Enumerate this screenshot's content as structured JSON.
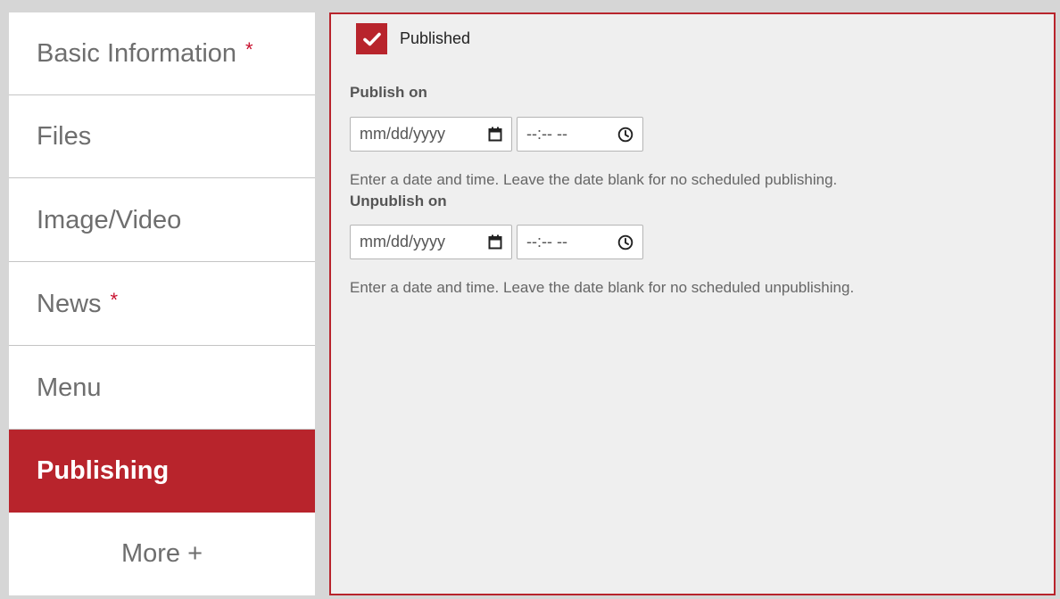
{
  "sidebar": {
    "tabs": [
      {
        "label": "Basic Information",
        "required": "*"
      },
      {
        "label": "Files"
      },
      {
        "label": "Image/Video"
      },
      {
        "label": "News",
        "required": "*"
      },
      {
        "label": "Menu"
      },
      {
        "label": "Publishing",
        "active": true
      },
      {
        "label": "More +"
      }
    ]
  },
  "panel": {
    "published_label": "Published",
    "publish_on": {
      "label": "Publish on",
      "date_placeholder": "mm/dd/yyyy",
      "time_placeholder": "--:-- --",
      "help": "Enter a date and time. Leave the date blank for no scheduled publishing."
    },
    "unpublish_on": {
      "label": "Unpublish on",
      "date_placeholder": "mm/dd/yyyy",
      "time_placeholder": "--:-- --",
      "help": "Enter a date and time. Leave the date blank for no scheduled unpublishing."
    }
  },
  "colors": {
    "accent": "#b8242c",
    "required": "#c8102e"
  },
  "icons": [
    "check-icon",
    "calendar-icon",
    "clock-icon"
  ]
}
